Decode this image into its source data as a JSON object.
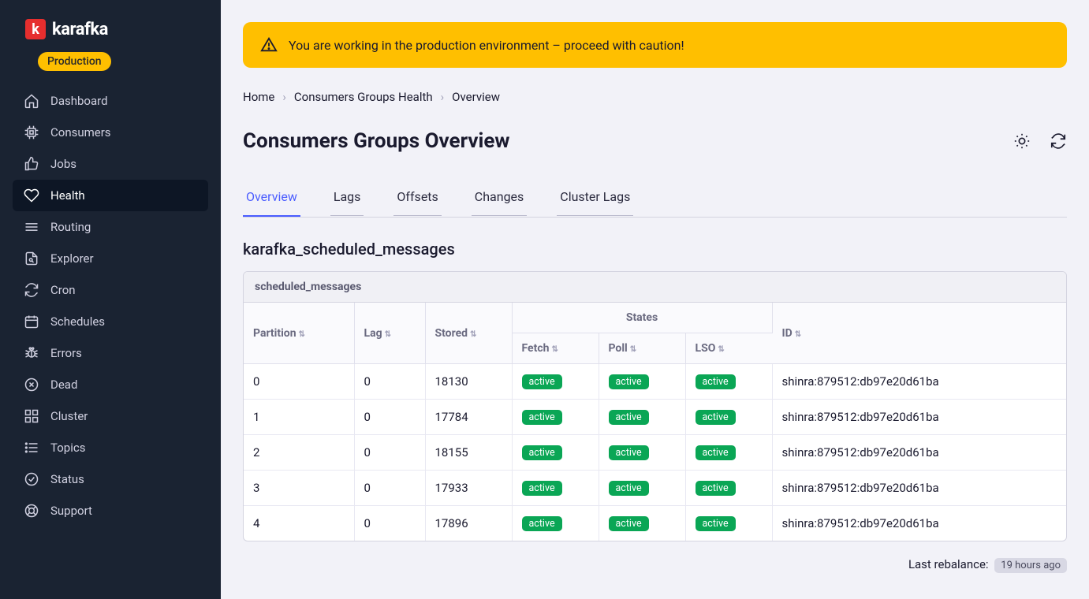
{
  "brand": {
    "logo_letter": "k",
    "name": "karafka",
    "env_label": "Production"
  },
  "sidebar": {
    "items": [
      {
        "label": "Dashboard",
        "icon": "home"
      },
      {
        "label": "Consumers",
        "icon": "cpu"
      },
      {
        "label": "Jobs",
        "icon": "thumbs-up"
      },
      {
        "label": "Health",
        "icon": "heart",
        "active": true
      },
      {
        "label": "Routing",
        "icon": "lines"
      },
      {
        "label": "Explorer",
        "icon": "file"
      },
      {
        "label": "Cron",
        "icon": "refresh"
      },
      {
        "label": "Schedules",
        "icon": "calendar"
      },
      {
        "label": "Errors",
        "icon": "bug"
      },
      {
        "label": "Dead",
        "icon": "x-circle"
      },
      {
        "label": "Cluster",
        "icon": "grid"
      },
      {
        "label": "Topics",
        "icon": "list"
      },
      {
        "label": "Status",
        "icon": "check-circle"
      },
      {
        "label": "Support",
        "icon": "life-buoy"
      }
    ]
  },
  "banner": {
    "text": "You are working in the production environment – proceed with caution!"
  },
  "breadcrumb": {
    "items": [
      "Home",
      "Consumers Groups Health",
      "Overview"
    ]
  },
  "page": {
    "title": "Consumers Groups Overview"
  },
  "tabs": {
    "items": [
      {
        "label": "Overview",
        "active": true
      },
      {
        "label": "Lags"
      },
      {
        "label": "Offsets"
      },
      {
        "label": "Changes"
      },
      {
        "label": "Cluster Lags"
      }
    ]
  },
  "section": {
    "title": "karafka_scheduled_messages"
  },
  "table": {
    "caption": "scheduled_messages",
    "columns": {
      "partition": "Partition",
      "lag": "Lag",
      "stored": "Stored",
      "states": "States",
      "fetch": "Fetch",
      "poll": "Poll",
      "lso": "LSO",
      "id": "ID"
    },
    "status_label": "active",
    "rows": [
      {
        "partition": "0",
        "lag": "0",
        "stored": "18130",
        "fetch": "active",
        "poll": "active",
        "lso": "active",
        "id": "shinra:879512:db97e20d61ba"
      },
      {
        "partition": "1",
        "lag": "0",
        "stored": "17784",
        "fetch": "active",
        "poll": "active",
        "lso": "active",
        "id": "shinra:879512:db97e20d61ba"
      },
      {
        "partition": "2",
        "lag": "0",
        "stored": "18155",
        "fetch": "active",
        "poll": "active",
        "lso": "active",
        "id": "shinra:879512:db97e20d61ba"
      },
      {
        "partition": "3",
        "lag": "0",
        "stored": "17933",
        "fetch": "active",
        "poll": "active",
        "lso": "active",
        "id": "shinra:879512:db97e20d61ba"
      },
      {
        "partition": "4",
        "lag": "0",
        "stored": "17896",
        "fetch": "active",
        "poll": "active",
        "lso": "active",
        "id": "shinra:879512:db97e20d61ba"
      }
    ]
  },
  "footer": {
    "label": "Last rebalance:",
    "value": "19 hours ago"
  }
}
